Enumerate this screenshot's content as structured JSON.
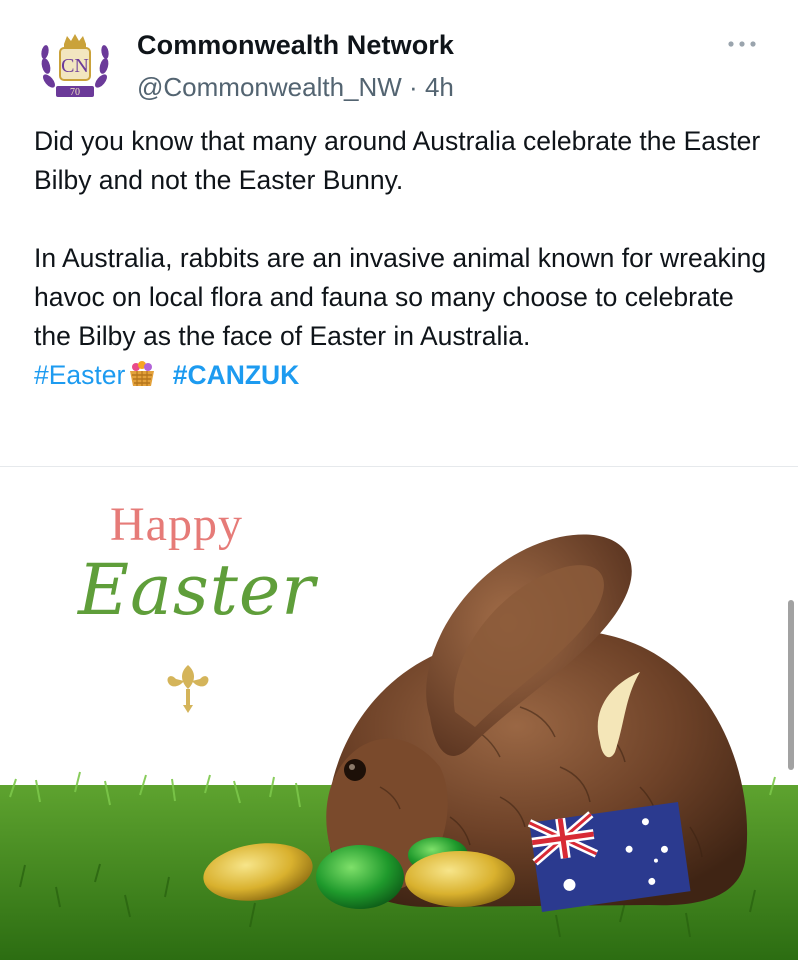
{
  "author": {
    "name": "Commonwealth Network",
    "handle": "@Commonwealth_NW",
    "separator": "·",
    "time": "4h",
    "avatar_text": "CN",
    "avatar_badge": "70"
  },
  "tweet": {
    "paragraph1": "Did you know that many around Australia celebrate the Easter Bilby and not the Easter Bunny.",
    "paragraph2": "In Australia, rabbits are an invasive animal known for wreaking havoc on local flora and fauna so many choose to celebrate the Bilby as the face of Easter in Australia.",
    "hashtags": [
      "#Easter",
      "#CANZUK"
    ]
  },
  "media": {
    "greeting_line1": "Happy",
    "greeting_line2": "Easter",
    "subject": "chocolate bilby",
    "colors": {
      "grass": "#3f8a1f",
      "chocolate": "#6e4228",
      "greeting_red": "#e67b78",
      "greeting_green": "#5f9e3a"
    }
  },
  "icons": [
    "more-options-icon",
    "basket-emoji-icon",
    "australian-flag-icon"
  ],
  "colors": {
    "link": "#1d9bf0",
    "text": "#0f1419",
    "secondary": "#536471"
  }
}
